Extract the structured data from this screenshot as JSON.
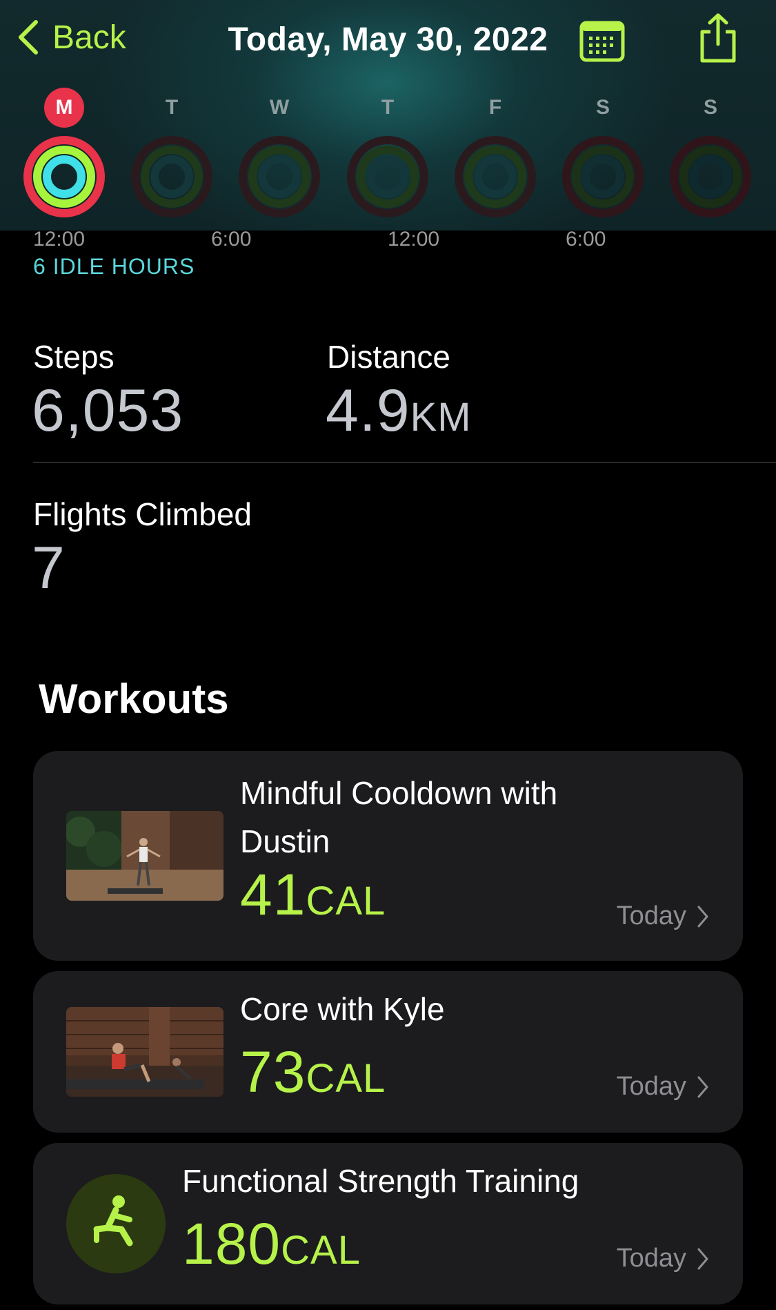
{
  "nav": {
    "back_label": "Back",
    "title": "Today, May 30, 2022",
    "calendar_icon": "calendar-icon",
    "share_icon": "share-icon"
  },
  "week": [
    {
      "letter": "M",
      "today": true
    },
    {
      "letter": "T",
      "today": false
    },
    {
      "letter": "W",
      "today": false
    },
    {
      "letter": "T",
      "today": false
    },
    {
      "letter": "F",
      "today": false
    },
    {
      "letter": "S",
      "today": false
    },
    {
      "letter": "S",
      "today": false
    }
  ],
  "timeline": {
    "ticks": [
      "12:00",
      "6:00",
      "12:00",
      "6:00"
    ],
    "idle_text": "6 IDLE HOURS"
  },
  "stats": {
    "steps_label": "Steps",
    "steps_value": "6,053",
    "distance_label": "Distance",
    "distance_value": "4.9",
    "distance_unit": "KM",
    "flights_label": "Flights Climbed",
    "flights_value": "7"
  },
  "workouts": {
    "title": "Workouts",
    "items": [
      {
        "name_line1": "Mindful Cooldown with",
        "name_line2": "Dustin",
        "cal": "41",
        "unit": "CAL",
        "date": "Today"
      },
      {
        "name_line1": "Core with Kyle",
        "cal": "73",
        "unit": "CAL",
        "date": "Today"
      },
      {
        "name_line1": "Functional Strength Training",
        "cal": "180",
        "unit": "CAL",
        "date": "Today",
        "icon": "strength-training-icon"
      }
    ]
  },
  "colors": {
    "accent_green": "#b6f24a",
    "move_red": "#e8334a",
    "exercise_green": "#a6f53c",
    "stand_cyan": "#3fe0e8",
    "idle_cyan": "#5bd7dc"
  }
}
